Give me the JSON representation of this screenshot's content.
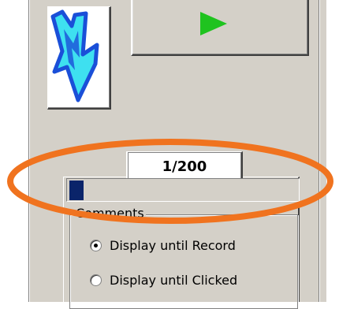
{
  "counter": {
    "text": "1/200"
  },
  "progress": {
    "current": 1,
    "total": 200
  },
  "comments": {
    "label": "Comments",
    "options": [
      {
        "label": "Display until Record",
        "selected": true
      },
      {
        "label": "Display until Clicked",
        "selected": false
      }
    ]
  },
  "icons": {
    "download": "down-arrow-icon",
    "play": "play-icon"
  },
  "colors": {
    "panel": "#d4d0c8",
    "arrow_fill": "#3ee0f0",
    "arrow_stroke": "#1a4fd8",
    "play": "#1fc31f",
    "progress": "#0a246a",
    "highlight": "#f0731f"
  }
}
